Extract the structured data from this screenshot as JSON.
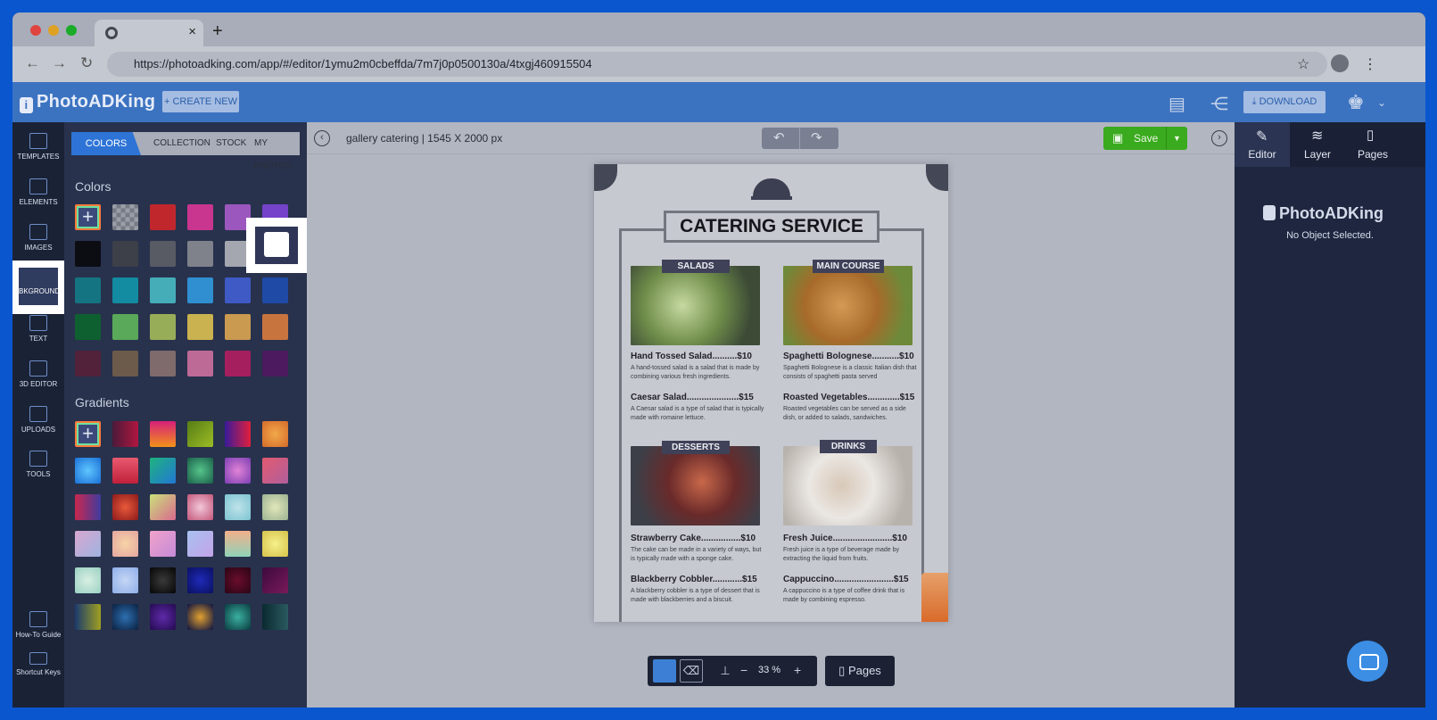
{
  "browser": {
    "url": "https://photoadking.com/app/#/editor/1ymu2m0cbeffda/7m7j0p0500130a/4txgj460915504",
    "tab_close": "×",
    "new_tab": "+"
  },
  "header": {
    "logo": "PhotoADKing",
    "create_new": "+ CREATE NEW",
    "download": "DOWNLOAD"
  },
  "rail": {
    "items": [
      "TEMPLATES",
      "ELEMENTS",
      "IMAGES",
      "BKGROUND",
      "TEXT",
      "3D EDITOR",
      "UPLOADS",
      "TOOLS"
    ],
    "bottom": [
      "How-To Guide",
      "Shortcut Keys"
    ]
  },
  "panel": {
    "tabs": [
      "COLORS",
      "COLLECTION",
      "STOCK",
      "MY PHOTOS"
    ],
    "colors_title": "Colors",
    "gradients_title": "Gradients",
    "colors": [
      [
        "add",
        "transparent",
        "#c0272d",
        "#c9368f",
        "#9b57be",
        "#7443c9"
      ],
      [
        "#0b0d12",
        "#3d4048",
        "#585b63",
        "#7f828a",
        "#a4a7af",
        "#ffffff"
      ],
      [
        "#157481",
        "#138ba0",
        "#45adb8",
        "#2f8fd0",
        "#3f5ac4",
        "#1f4aa6"
      ],
      [
        "#0f6030",
        "#5aa85a",
        "#98ad58",
        "#c9b24f",
        "#c99a4f",
        "#c8743f"
      ],
      [
        "#52223a",
        "#6c5a4a",
        "#7f6b6c",
        "#bd6a96",
        "#a51f5e",
        "#4c1a5e"
      ]
    ],
    "gradients": [
      [
        "add",
        "linear-gradient(90deg,#4b1a3a,#b0163f)",
        "linear-gradient(180deg,#d61f7a,#f2921a)",
        "linear-gradient(135deg,#567d15,#9cbc25)",
        "linear-gradient(90deg,#3a1a9a,#e01f3d)",
        "radial-gradient(#f2a94a,#d46a2a)"
      ],
      [
        "radial-gradient(#5fc6ff,#1a6fd6)",
        "linear-gradient(180deg,#e85a6f,#c0203a)",
        "linear-gradient(135deg,#1fb37f,#2277d4)",
        "radial-gradient(#55c48a,#1a5f4a)",
        "radial-gradient(#e083d6,#7d3fb3)",
        "linear-gradient(135deg,#e35a6f,#b05f9d)"
      ],
      [
        "linear-gradient(90deg,#c9274d,#3f3c9e)",
        "radial-gradient(#e8593a,#8c1a1a)",
        "linear-gradient(135deg,#c9e07a,#d96a8e)",
        "radial-gradient(#f2c7d8,#c2567a)",
        "radial-gradient(#bfe3ea,#7cc3d1)",
        "radial-gradient(#e2e6b9,#9ab292)"
      ],
      [
        "linear-gradient(135deg,#d7a7d0,#9fb3e0)",
        "radial-gradient(#f7d3a6,#e3a5a0)",
        "linear-gradient(135deg,#f0a3c9,#c58ad8)",
        "linear-gradient(135deg,#a8c1f0,#c3a3e8)",
        "linear-gradient(180deg,#f3b08a,#8fd3b8)",
        "radial-gradient(#f4f08a,#d6c24a)"
      ],
      [
        "radial-gradient(#d8efe3,#9ad1c3)",
        "radial-gradient(#c5d6f5,#8eaee8)",
        "radial-gradient(#3a3a3a,#050505)",
        "radial-gradient(#1f2ab8,#0a1060)",
        "radial-gradient(#6a0d2c,#2a0515)",
        "linear-gradient(135deg,#3c0a3e,#7a1a5a)"
      ],
      [
        "linear-gradient(90deg,#1a3a6e,#a0a020)",
        "radial-gradient(#2d6fb0,#0b2040)",
        "radial-gradient(#5e2aa8,#240a50)",
        "radial-gradient(#e0a030,#0a1040)",
        "radial-gradient(#3ab0a0,#0a3a40)",
        "linear-gradient(90deg,#0a2a30,#2a5a60)"
      ]
    ]
  },
  "canvas": {
    "doc_title": "gallery catering | 1545 X 2000 px",
    "save": "Save",
    "zoom": "33 %",
    "pages": "Pages",
    "poster": {
      "title": "CATERING SERVICE",
      "sections": [
        {
          "label": "SALADS",
          "items": [
            {
              "title": "Hand Tossed Salad..........$10",
              "desc": "A hand-tossed salad is a salad that is made by combining various fresh ingredients."
            },
            {
              "title": "Caesar Salad.....................$15",
              "desc": "A Caesar salad is a type of salad that is typically made with romaine lettuce."
            }
          ]
        },
        {
          "label": "MAIN COURSE",
          "items": [
            {
              "title": "Spaghetti Bolognese...........$10",
              "desc": "Spaghetti Bolognese is a classic Italian dish that consists of spaghetti pasta served"
            },
            {
              "title": "Roasted Vegetables.............$15",
              "desc": "Roasted vegetables can be served as a side dish, or added to salads, sandwiches."
            }
          ]
        },
        {
          "label": "DESSERTS",
          "items": [
            {
              "title": "Strawberry Cake................$10",
              "desc": "The cake can be made in a variety of ways, but is typically made with a sponge cake."
            },
            {
              "title": "Blackberry Cobbler............$15",
              "desc": "A blackberry cobbler is a type of dessert that is made with blackberries and a biscuit."
            }
          ]
        },
        {
          "label": "DRINKS",
          "items": [
            {
              "title": "Fresh Juice........................$10",
              "desc": "Fresh juice is a type of beverage made by extracting the liquid from fruits."
            },
            {
              "title": "Cappuccino........................$15",
              "desc": "A cappuccino is a type of coffee drink that is made by combining espresso."
            }
          ]
        }
      ]
    }
  },
  "right": {
    "tabs": [
      "Editor",
      "Layer",
      "Pages"
    ],
    "logo": "PhotoADKing",
    "empty": "No Object Selected."
  }
}
